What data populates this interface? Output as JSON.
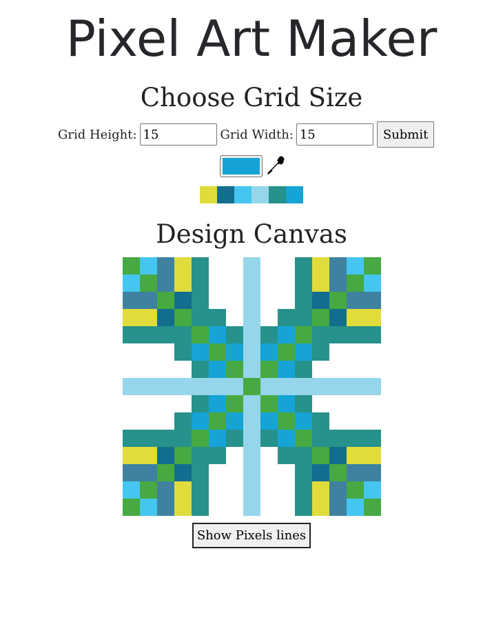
{
  "title": "Pixel Art Maker",
  "grid_form": {
    "heading": "Choose Grid Size",
    "height_label": "Grid Height:",
    "height_value": "15",
    "width_label": "Grid Width:",
    "width_value": "15",
    "submit_label": "Submit"
  },
  "color_picker": {
    "current_color": "#16a3d6",
    "eyedropper_icon": "eyedropper-icon"
  },
  "palette": [
    "#e0dc3c",
    "#136d8f",
    "#45c6f0",
    "#96d6ea",
    "#27918b",
    "#16a3d6"
  ],
  "canvas": {
    "heading": "Design Canvas",
    "rows": 15,
    "cols": 15,
    "colors": {
      "W": "#ffffff",
      "G": "#46a941",
      "C": "#45c6f0",
      "S": "#3e82a0",
      "Y": "#e0dc3c",
      "T": "#27918b",
      "L": "#96d6ea",
      "N": "#136d8f",
      "B": "#16a3d6"
    },
    "pixels": [
      "GCSYTWWLWWTYSCG",
      "CGSYTWWLWWTYSGC",
      "SSGNTWWLWWTNGSS",
      "YYNGTTWLWTTGNYY",
      "TTTTGBTLTBGTTTT",
      "WWWTBGBLBGBTWWW",
      "WWWWTBGLGBTWWWW",
      "LLLLLLLGLLLLLLL",
      "WWWWTBGLGBTWWWW",
      "WWWTBGBLBGBTWWW",
      "TTTTGBTLTBGTTTT",
      "YYNGTTWLWTTGNYY",
      "SSGNTWWLWWTNGSS",
      "CGSYTWWLWWTYSGC",
      "GCSYTWWLWWTYSCG"
    ]
  },
  "show_lines_label": "Show Pixels lines"
}
